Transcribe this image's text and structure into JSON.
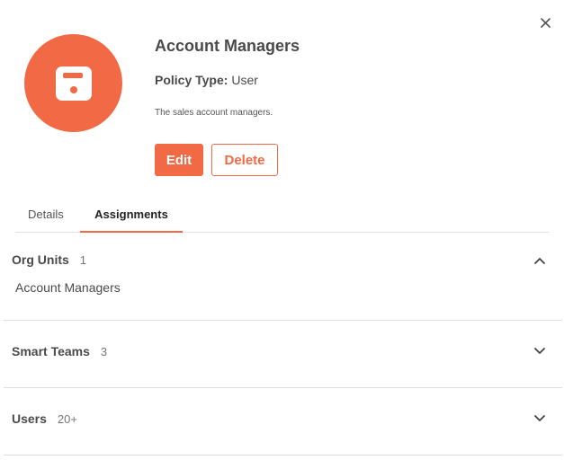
{
  "header": {
    "title": "Account Managers",
    "policy_type_label": "Policy Type:",
    "policy_type_value": "User",
    "description": "The sales account managers.",
    "avatar_icon": "floppy-disk-icon",
    "close_icon": "close-icon"
  },
  "actions": {
    "edit_label": "Edit",
    "delete_label": "Delete"
  },
  "tabs": [
    {
      "label": "Details",
      "active": false
    },
    {
      "label": "Assignments",
      "active": true
    }
  ],
  "sections": [
    {
      "name": "Org Units",
      "count": "1",
      "expanded": true,
      "items": [
        "Account Managers"
      ]
    },
    {
      "name": "Smart Teams",
      "count": "3",
      "expanded": false
    },
    {
      "name": "Users",
      "count": "20+",
      "expanded": false
    }
  ],
  "colors": {
    "accent": "#f26a45",
    "text": "#4a4a4a",
    "divider": "#dedede"
  }
}
